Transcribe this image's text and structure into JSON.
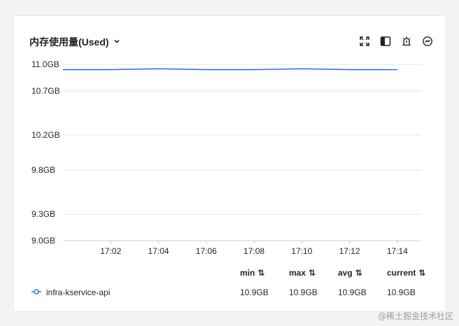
{
  "panel": {
    "title": "内存使用量(Used)",
    "dropdown_icon": "chevron-down-icon",
    "toolbar_icons": [
      "expand-icon",
      "split-view-icon",
      "alarm-icon",
      "trend-icon"
    ]
  },
  "chart_data": {
    "type": "line",
    "ylim": [
      9.0,
      11.0
    ],
    "y_ticks": [
      9.0,
      9.3,
      9.8,
      10.2,
      10.7,
      11.0
    ],
    "y_tick_labels": [
      "9.0GB",
      "9.3GB",
      "9.8GB",
      "10.2GB",
      "10.7GB",
      "11.0GB"
    ],
    "x_tick_labels": [
      "17:02",
      "17:04",
      "17:06",
      "17:08",
      "17:10",
      "17:12",
      "17:14"
    ],
    "x_range": [
      "17:00",
      "17:15"
    ],
    "grid": true,
    "series": [
      {
        "name": "infra-kservice-api",
        "color": "#3370ff",
        "x": [
          "17:00",
          "17:02",
          "17:04",
          "17:06",
          "17:08",
          "17:10",
          "17:12",
          "17:14"
        ],
        "values": [
          10.94,
          10.94,
          10.95,
          10.94,
          10.94,
          10.95,
          10.94,
          10.94
        ]
      }
    ]
  },
  "legend": {
    "headers": {
      "min": "min",
      "max": "max",
      "avg": "avg",
      "current": "current"
    },
    "rows": [
      {
        "name": "infra-kservice-api",
        "min": "10.9GB",
        "max": "10.9GB",
        "avg": "10.9GB",
        "current": "10.9GB"
      }
    ]
  },
  "watermark": "@稀土掘金技术社区"
}
